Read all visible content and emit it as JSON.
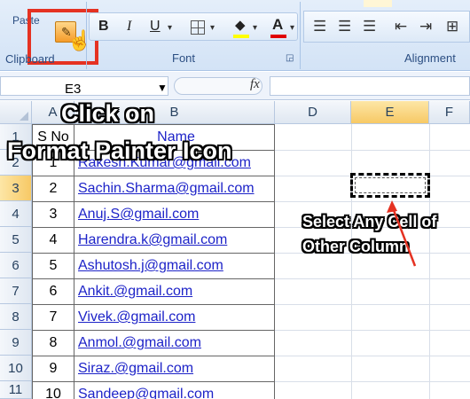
{
  "ribbon": {
    "paste_label": "Paste",
    "clipboard_label": "Clipboard",
    "font_label": "Font",
    "alignment_label": "Alignment",
    "bold_label": "B",
    "italic_label": "I",
    "underline_label": "U",
    "font_color_label": "A",
    "fill_color": "#ffff00",
    "font_color": "#e00000",
    "highlight_color": "#e53222"
  },
  "formula_bar": {
    "name_box": "E3",
    "fx_label": "fx",
    "formula": ""
  },
  "columns": [
    "A",
    "B",
    "D",
    "E",
    "F"
  ],
  "selected_column": "E",
  "rows": [
    "1",
    "2",
    "3",
    "4",
    "5",
    "6",
    "7",
    "8",
    "9",
    "10",
    "11"
  ],
  "selected_row": "3",
  "table": {
    "header": {
      "no": "S No",
      "name": "Name"
    },
    "rows": [
      {
        "no": "1",
        "name": "Rakesh.Kumar@gmail.com"
      },
      {
        "no": "2",
        "name": "Sachin.Sharma@gmail.com"
      },
      {
        "no": "3",
        "name": "Anuj.S@gmail.com"
      },
      {
        "no": "4",
        "name": "Harendra.k@gmail.com"
      },
      {
        "no": "5",
        "name": "Ashutosh.j@gmail.com"
      },
      {
        "no": "6",
        "name": "Ankit.@gmail.com"
      },
      {
        "no": "7",
        "name": "Vivek.@gmail.com"
      },
      {
        "no": "8",
        "name": "Anmol.@gmail.com"
      },
      {
        "no": "9",
        "name": "Siraz.@gmail.com"
      },
      {
        "no": "10",
        "name": "Sandeep@gmail.com"
      }
    ]
  },
  "annotations": {
    "click_line1": "Click on",
    "click_line2": "Format Painter Icon",
    "select_line1": "Select Any Cell of",
    "select_line2": "Other Column",
    "arrow_color": "#e53222"
  }
}
